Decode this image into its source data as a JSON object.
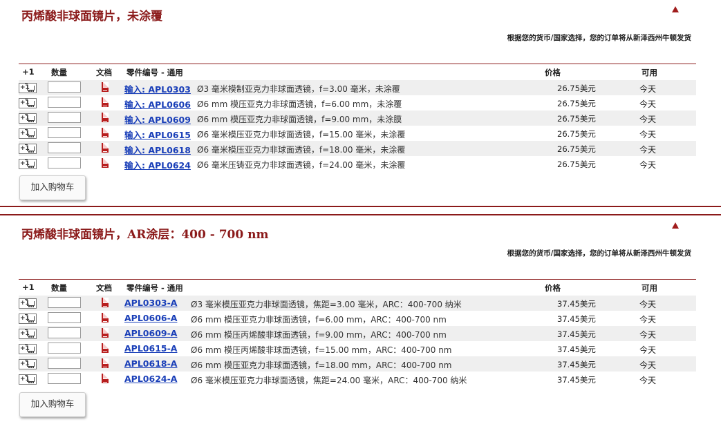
{
  "sections": [
    {
      "title": "丙烯酸非球面镜片，未涂覆",
      "shipping_note": "根据您的货币/国家选择，您的订单将从新泽西州牛顿发货",
      "columns": {
        "add": "+1",
        "qty": "数量",
        "doc": "文档",
        "part": "零件编号 - 通用",
        "price": "价格",
        "avail": "可用"
      },
      "rows": [
        {
          "part": "输入: APL0303",
          "desc": "Ø3 毫米模制亚克力非球面透镜，f=3.00 毫米，未涂覆",
          "price": "26.75美元",
          "avail": "今天"
        },
        {
          "part": "输入: APL0606",
          "desc": "Ø6 mm 模压亚克力非球面透镜，f=6.00 mm，未涂覆",
          "price": "26.75美元",
          "avail": "今天"
        },
        {
          "part": "输入: APL0609",
          "desc": "Ø6 mm 模压亚克力非球面透镜，f=9.00 mm，未涂膜",
          "price": "26.75美元",
          "avail": "今天"
        },
        {
          "part": "输入: APL0615",
          "desc": "Ø6 毫米模压亚克力非球面透镜，f=15.00 毫米，未涂覆",
          "price": "26.75美元",
          "avail": "今天"
        },
        {
          "part": "输入: APL0618",
          "desc": "Ø6 毫米模压亚克力非球面透镜，f=18.00 毫米，未涂覆",
          "price": "26.75美元",
          "avail": "今天"
        },
        {
          "part": "输入: APL0624",
          "desc": "Ø6 毫米压铸亚克力非球面透镜，f=24.00 毫米，未涂覆",
          "price": "26.75美元",
          "avail": "今天"
        }
      ],
      "add_to_cart": "加入购物车"
    },
    {
      "title": "丙烯酸非球面镜片，AR涂层：400 - 700 nm",
      "shipping_note": "根据您的货币/国家选择，您的订单将从新泽西州牛顿发货",
      "columns": {
        "add": "+1",
        "qty": "数量",
        "doc": "文档",
        "part": "零件编号 - 通用",
        "price": "价格",
        "avail": "可用"
      },
      "rows": [
        {
          "part": "APL0303-A",
          "desc": "Ø3 毫米模压亚克力非球面透镜，焦距=3.00 毫米，ARC：400-700 纳米",
          "price": "37.45美元",
          "avail": "今天"
        },
        {
          "part": "APL0606-A",
          "desc": "Ø6 mm 模压亚克力非球面透镜，f=6.00 mm，ARC：400-700 nm",
          "price": "37.45美元",
          "avail": "今天"
        },
        {
          "part": "APL0609-A",
          "desc": "Ø6 mm 模压丙烯酸非球面透镜，f=9.00 mm，ARC：400-700 nm",
          "price": "37.45美元",
          "avail": "今天"
        },
        {
          "part": "APL0615-A",
          "desc": "Ø6 mm 模压丙烯酸非球面透镜，f=15.00 mm，ARC：400-700 nm",
          "price": "37.45美元",
          "avail": "今天"
        },
        {
          "part": "APL0618-A",
          "desc": "Ø6 mm 模压亚克力非球面透镜，f=18.00 mm，ARC：400-700 nm",
          "price": "37.45美元",
          "avail": "今天"
        },
        {
          "part": "APL0624-A",
          "desc": "Ø6 毫米模压亚克力非球面透镜，焦距=24.00 毫米，ARC：400-700 纳米",
          "price": "37.45美元",
          "avail": "今天"
        }
      ],
      "add_to_cart": "加入购物车"
    }
  ],
  "colors": {
    "accent": "#8b1a1a",
    "link": "#1a3fb8",
    "row_alt": "#efefef",
    "doc_icon": "#b81e1e"
  },
  "icons": {
    "add": "add-to-cart-icon",
    "doc": "pdf-document-icon",
    "toggle": "collapse-triangle-icon"
  }
}
